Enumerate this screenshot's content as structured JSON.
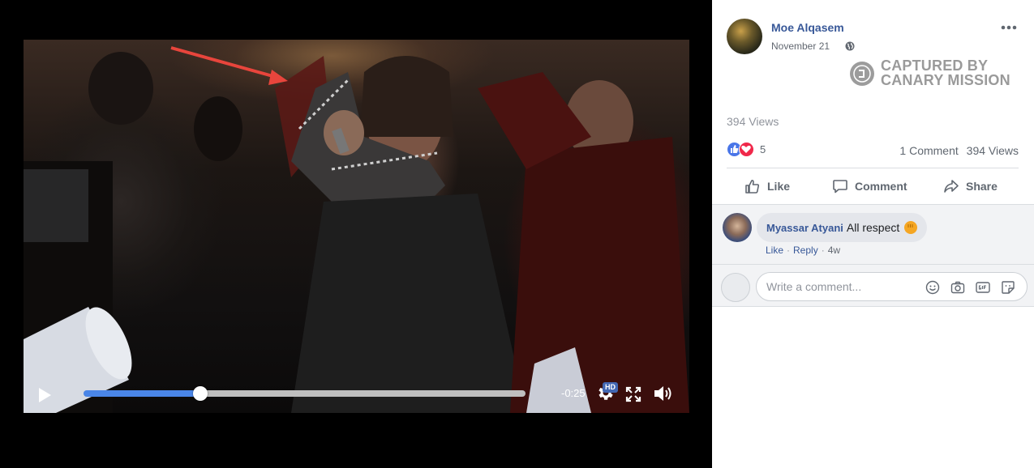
{
  "video": {
    "time_remaining": "-0:25",
    "progress_fraction": 0.265,
    "hd_label": "HD"
  },
  "post": {
    "author": "Moe Alqasem",
    "date": "November 21",
    "views_label": "394 Views",
    "reaction_count": "5",
    "comment_count_label": "1 Comment",
    "views_count_label": "394 Views"
  },
  "watermark": {
    "line1": "CAPTURED BY",
    "line2": "CANARY MISSION"
  },
  "actions": {
    "like": "Like",
    "comment": "Comment",
    "share": "Share"
  },
  "comment": {
    "author": "Myassar Atyani",
    "text": "All respect",
    "like": "Like",
    "reply": "Reply",
    "age": "4w"
  },
  "composer": {
    "placeholder": "Write a comment..."
  },
  "colors": {
    "link": "#385898",
    "progress": "#4a86e8",
    "like": "#4a76e8",
    "love": "#f0284a",
    "arrow": "#e8453c"
  }
}
